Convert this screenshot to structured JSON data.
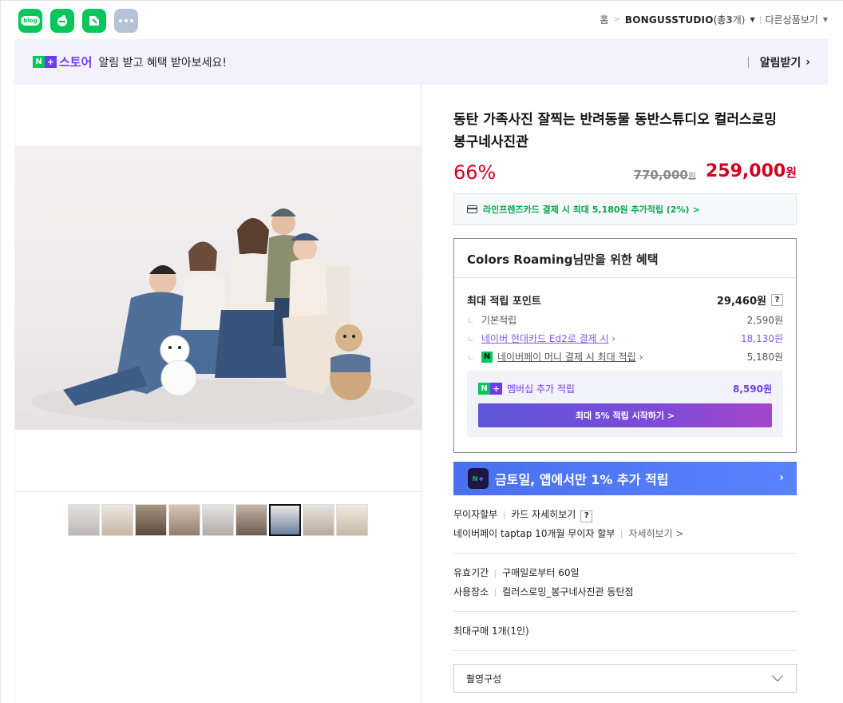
{
  "breadcrumb": {
    "home": "홈",
    "store": "BONGUSSTUDIO",
    "count_open": "(총 ",
    "count": "3",
    "count_close": "개)",
    "other": "다른상품보기"
  },
  "banner": {
    "store_word": "스토어",
    "message": "알림 받고 혜택 받아보세요!",
    "alarm": "알림받기"
  },
  "product": {
    "title": "동탄 가족사진 잘찍는 반려동물 동반스튜디오 컬러스로밍 봉구네사진관",
    "discount": "66%",
    "original_price": "770,000",
    "original_unit": "원",
    "sale_price": "259,000",
    "sale_unit": "원",
    "card_promo": "라인프렌즈카드 결제 시 최대 5,180원 추가적립 (2%) >"
  },
  "benefit": {
    "heading": "Colors Roaming님만을 위한 혜택",
    "max_label": "최대 적립 포인트",
    "max_value": "29,460원",
    "basic_label": "기본적립",
    "basic_value": "2,590원",
    "card_label": "네이버 현대카드 Ed2로 결제 시",
    "card_value": "18,130원",
    "pay_label": "네이버페이 머니 결제 시 최대 적립",
    "pay_value": "5,180원",
    "member_label": "멤버십 추가 적립",
    "member_value": "8,590원",
    "member_button": "최대 5% 적립 시작하기 >"
  },
  "promo": {
    "text": "금토일, 앱에서만 1% 추가 적립"
  },
  "info": {
    "installment": "무이자할부",
    "card_detail": "카드 자세히보기",
    "taptap": "네이버페이 taptap 10개월 무이자 할부",
    "taptap_detail": "자세히보기 >",
    "validity_label": "유효기간",
    "validity_value": "구매일로부터 60일",
    "place_label": "사용장소",
    "place_value": "컬러스로밍_봉구네사진관 동탄점",
    "max_purchase": "최대구매 1개(1인)",
    "option_select": "촬영구성"
  },
  "thumbnails": 9,
  "selected_thumbnail": 7,
  "colors": {
    "naver_green": "#03c75a",
    "price_red": "#d1001f",
    "npay_purple": "#6e3cf0",
    "promo_blue": "#4a6ff0"
  }
}
